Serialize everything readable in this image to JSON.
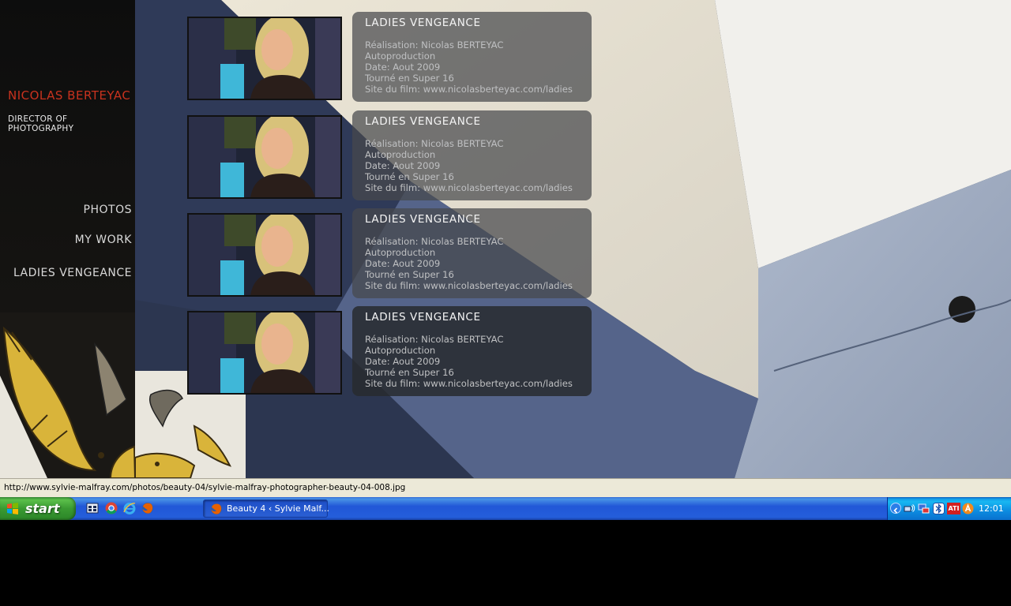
{
  "site": {
    "brand_name": "NICOLAS BERTEYAC",
    "brand_subtitle": "DIRECTOR OF PHOTOGRAPHY",
    "nav": [
      {
        "label": "PHOTOS"
      },
      {
        "label": "MY WORK"
      },
      {
        "label": "LADIES VENGEANCE"
      }
    ],
    "cards": [
      {
        "title": "LADIES VENGEANCE",
        "lines": [
          "Réalisation: Nicolas BERTEYAC",
          "Autoproduction",
          "Date: Aout 2009",
          "Tourné en Super 16",
          "Site du film: www.nicolasberteyac.com/ladies"
        ]
      },
      {
        "title": "LADIES VENGEANCE",
        "lines": [
          "Réalisation: Nicolas BERTEYAC",
          "Autoproduction",
          "Date: Aout 2009",
          "Tourné en Super 16",
          "Site du film: www.nicolasberteyac.com/ladies"
        ]
      },
      {
        "title": "LADIES VENGEANCE",
        "lines": [
          "Réalisation: Nicolas BERTEYAC",
          "Autoproduction",
          "Date: Aout 2009",
          "Tourné en Super 16",
          "Site du film: www.nicolasberteyac.com/ladies"
        ]
      },
      {
        "title": "LADIES VENGEANCE",
        "lines": [
          "Réalisation: Nicolas BERTEYAC",
          "Autoproduction",
          "Date: Aout 2009",
          "Tourné en Super 16",
          "Site du film: www.nicolasberteyac.com/ladies"
        ]
      }
    ]
  },
  "statusbar": {
    "url": "http://www.sylvie-malfray.com/photos/beauty-04/sylvie-malfray-photographer-beauty-04-008.jpg"
  },
  "taskbar": {
    "start_label": "start",
    "quick_launch": [
      "show-desktop-icon",
      "chrome-icon",
      "internet-explorer-icon",
      "firefox-icon"
    ],
    "window_button": "Beauty 4 ‹ Sylvie Malf...",
    "tray_icons": [
      "network-icon",
      "monitor-icon",
      "bluetooth-icon",
      "ati-icon",
      "avast-icon"
    ],
    "tray_ati_label": "ATI",
    "clock": "12:01"
  },
  "colors": {
    "brand_red": "#c8321e",
    "taskbar_blue": "#245edb",
    "start_green": "#3a9a32"
  }
}
